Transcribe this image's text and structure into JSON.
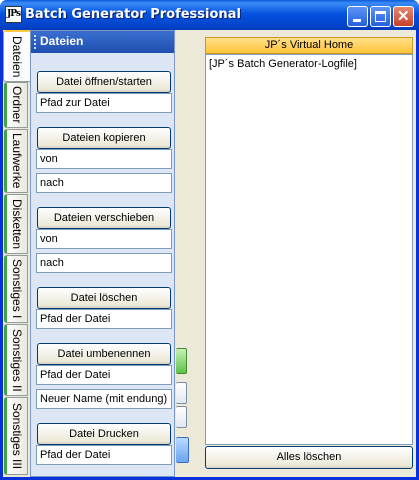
{
  "window": {
    "title": "Batch Generator Professional",
    "icon_label": "JPs"
  },
  "tabs": [
    {
      "label": "Dateien",
      "active": true
    },
    {
      "label": "Ordner",
      "active": false
    },
    {
      "label": "Laufwerke",
      "active": false
    },
    {
      "label": "Disketten",
      "active": false
    },
    {
      "label": "Sonstiges I",
      "active": false
    },
    {
      "label": "Sonstiges II",
      "active": false
    },
    {
      "label": "Sonstiges III",
      "active": false
    }
  ],
  "panel": {
    "title": "Dateien",
    "open": {
      "button": "Datei öffnen/starten",
      "path_placeholder": "Pfad zur Datei"
    },
    "copy": {
      "button": "Dateien kopieren",
      "from_placeholder": "von",
      "to_placeholder": "nach"
    },
    "move": {
      "button": "Dateien verschieben",
      "from_placeholder": "von",
      "to_placeholder": "nach"
    },
    "delete": {
      "button": "Datei löschen",
      "path_placeholder": "Pfad der Datei"
    },
    "rename": {
      "button": "Datei umbenennen",
      "path_placeholder": "Pfad der Datei",
      "newname_placeholder": "Neuer Name (mit endung)"
    },
    "print": {
      "button": "Datei Drucken",
      "path_placeholder": "Pfad der Datei"
    }
  },
  "log": {
    "header": "JP´s Virtual Home",
    "lines": [
      "[JP´s Batch Generator-Logfile]"
    ],
    "clear_button": "Alles löschen"
  },
  "colors": {
    "title_bar": "#0553e0",
    "panel_bg": "#dde6f4",
    "log_header": "#ffc33a",
    "tab_accent": "#3fa53f"
  }
}
